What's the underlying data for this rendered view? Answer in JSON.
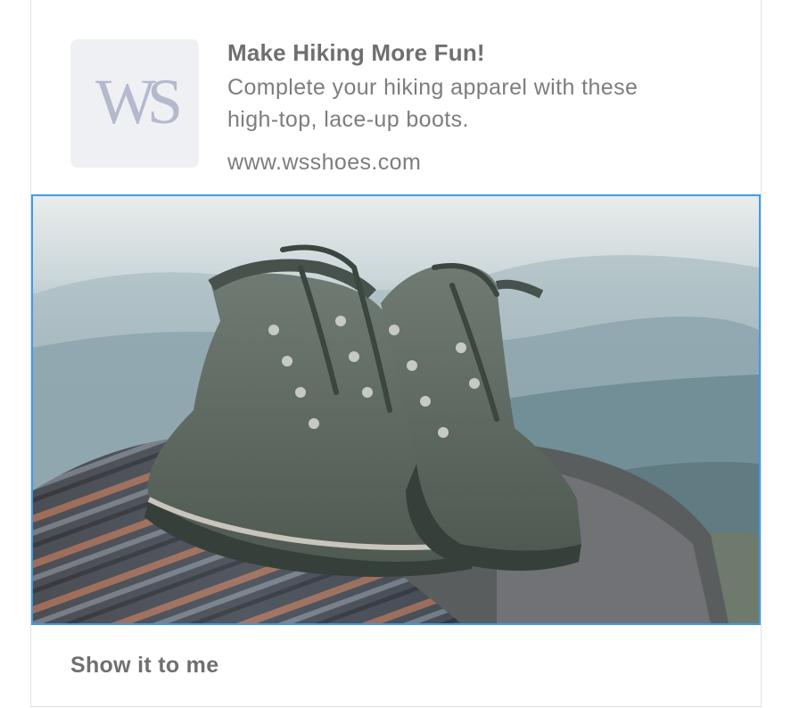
{
  "ad": {
    "logo_text": "WS",
    "title": "Make Hiking More Fun!",
    "description_line1": "Complete your hiking apparel with these",
    "description_line2": "high-top, lace-up boots.",
    "url": "www.wsshoes.com",
    "cta_label": "Show it to me",
    "image_subject": "pair of grey-green hiking boots on a striped blanket atop a rock with misty mountains behind"
  },
  "colors": {
    "frame_highlight": "#3f9be8",
    "logo_bg": "#eef0f4",
    "logo_fg": "#b4b9cc",
    "text_primary": "#6f6f6f",
    "text_secondary": "#7d7d7d"
  }
}
